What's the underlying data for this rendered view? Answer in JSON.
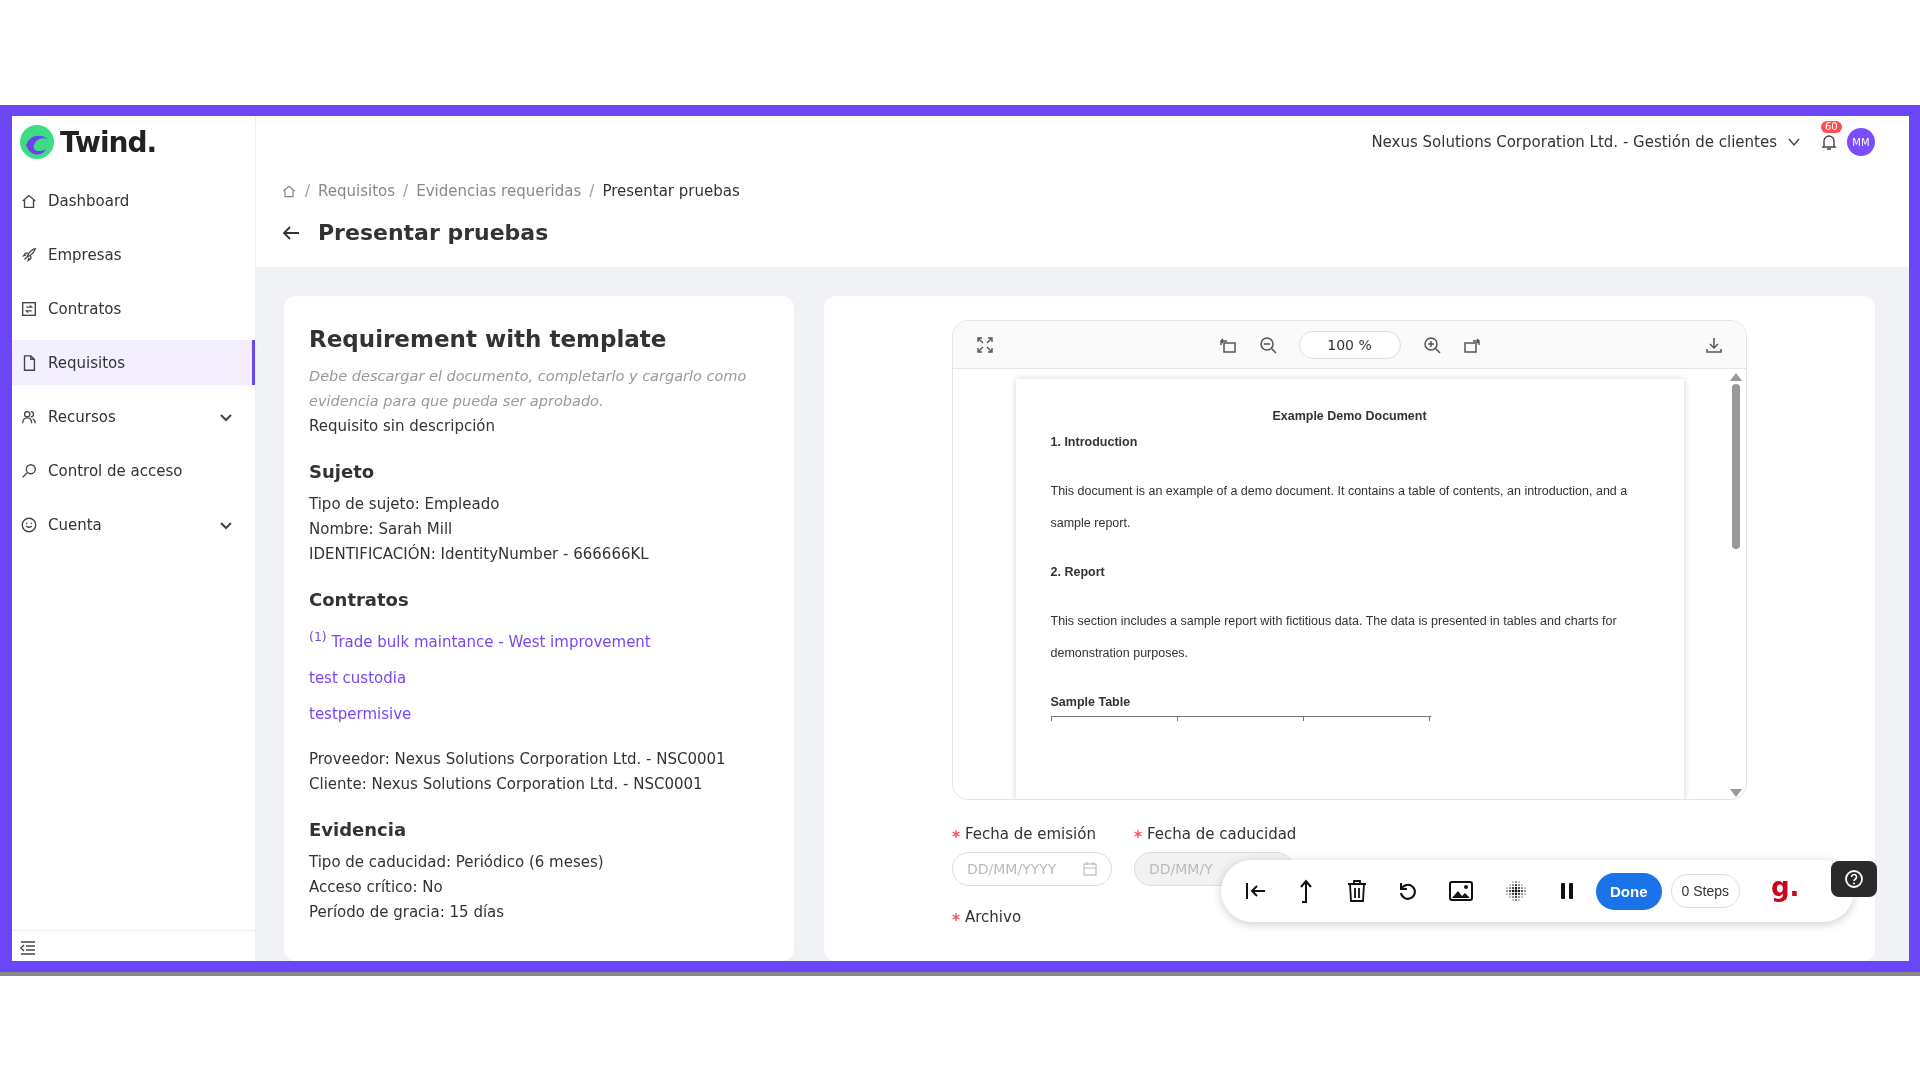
{
  "logo": {
    "text": "Twind."
  },
  "sidebar": {
    "items": [
      {
        "label": "Dashboard",
        "selected": false,
        "expandable": false
      },
      {
        "label": "Empresas",
        "selected": false,
        "expandable": false
      },
      {
        "label": "Contratos",
        "selected": false,
        "expandable": false
      },
      {
        "label": "Requisitos",
        "selected": true,
        "expandable": false
      },
      {
        "label": "Recursos",
        "selected": false,
        "expandable": true
      },
      {
        "label": "Control de acceso",
        "selected": false,
        "expandable": false
      },
      {
        "label": "Cuenta",
        "selected": false,
        "expandable": true
      }
    ]
  },
  "header": {
    "organization": "Nexus Solutions Corporation Ltd. - Gestión de clientes",
    "notification_count": "60",
    "avatar": "MM"
  },
  "breadcrumb": [
    {
      "separator": "/",
      "label": "Requisitos"
    },
    {
      "separator": "/",
      "label": "Evidencias requeridas"
    },
    {
      "separator": "/",
      "label": "Presentar pruebas"
    }
  ],
  "page_title": "Presentar pruebas",
  "requirement": {
    "title": "Requirement with template",
    "instructions": "Debe descargar el documento, completarlo y cargarlo como evidencia para que pueda ser aprobado.",
    "description": "Requisito sin descripción",
    "sections": [
      {
        "heading": "Sujeto",
        "lines": [
          "Tipo de sujeto: Empleado",
          "Nombre: Sarah Mill",
          "IDENTIFICACIÓN: IdentityNumber - 666666KL"
        ]
      },
      {
        "heading": "Contratos",
        "links": [
          "$^{(1)}$ Trade bulk maintance - West improvement",
          "test custodia",
          "testpermisive"
        ],
        "lines": [
          "Proveedor: Nexus Solutions Corporation Ltd. - NSC0001",
          "Cliente: Nexus Solutions Corporation Ltd. - NSC0001"
        ]
      },
      {
        "heading": "Evidencia",
        "lines": [
          "Tipo de caducidad: Periódico (6 meses)",
          "Acceso crítico: No",
          "Período de gracia: 15 días"
        ]
      }
    ]
  },
  "viewer": {
    "zoom": "100 %",
    "document": [
      {
        "kind": "title",
        "text": "Example Demo Document"
      },
      {
        "kind": "heading",
        "text": "1. Introduction"
      },
      {
        "kind": "paragraph",
        "text": "This document is an example of a demo document. It contains a table of contents, an introduction, and a sample report."
      },
      {
        "kind": "heading",
        "text": "2. Report"
      },
      {
        "kind": "paragraph",
        "text": "This section includes a sample report with fictitious data. The data is presented in tables and charts for demonstration purposes."
      },
      {
        "kind": "table",
        "text": "Sample Table"
      }
    ]
  },
  "form": {
    "fields": [
      {
        "label": "Fecha de emisión",
        "required": true,
        "placeholder": "DD/MM/YYYY",
        "disabled": false
      },
      {
        "label": "Fecha de caducidad",
        "required": true,
        "placeholder": "DD/MM/Y",
        "disabled": true
      }
    ],
    "file_label": {
      "label": "Archivo",
      "required": true
    }
  },
  "recorder": {
    "done": "Done",
    "steps": "0 Steps",
    "logo": "g.",
    "paused": false
  }
}
